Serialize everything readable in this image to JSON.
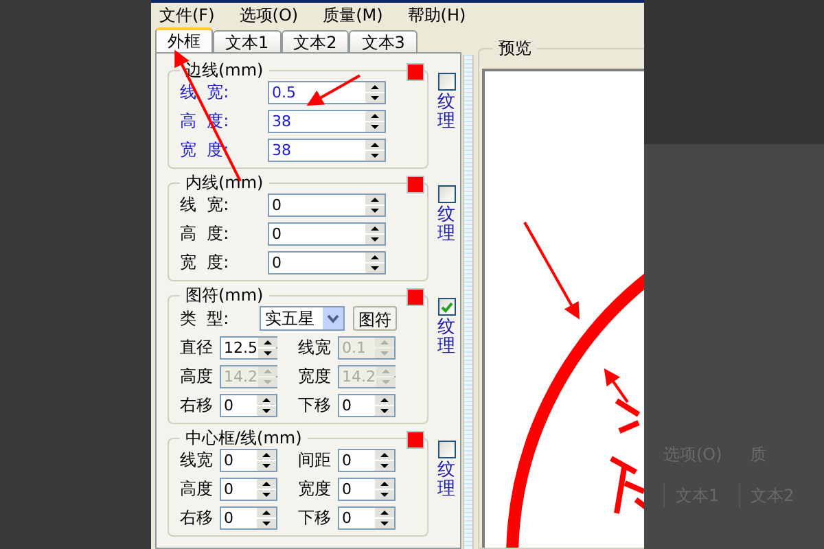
{
  "menu": [
    {
      "label": "文件(F)"
    },
    {
      "label": "选项(O)"
    },
    {
      "label": "质量(M)"
    },
    {
      "label": "帮助(H)"
    }
  ],
  "tabs": [
    {
      "label": "外框",
      "selected": true
    },
    {
      "label": "文本1",
      "selected": false
    },
    {
      "label": "文本2",
      "selected": false
    },
    {
      "label": "文本3",
      "selected": false
    }
  ],
  "groups": [
    {
      "kind": "single",
      "title": "边线(mm)",
      "highlighted": true,
      "color": "#ff0000",
      "texture": {
        "label": "纹理",
        "checked": false
      },
      "rows": [
        {
          "label": "线  宽:",
          "value": "0.5"
        },
        {
          "label": "高  度:",
          "value": "38"
        },
        {
          "label": "宽  度:",
          "value": "38"
        }
      ]
    },
    {
      "kind": "single",
      "title": "内线(mm)",
      "highlighted": false,
      "color": "#ff0000",
      "texture": {
        "label": "纹理",
        "checked": false
      },
      "rows": [
        {
          "label": "线  宽:",
          "value": "0"
        },
        {
          "label": "高  度:",
          "value": "0"
        },
        {
          "label": "宽  度:",
          "value": "0"
        }
      ]
    },
    {
      "kind": "pairs",
      "title": "图符(mm)",
      "color": "#ff0000",
      "texture": {
        "label": "纹理",
        "checked": true
      },
      "type_row": {
        "label": "类  型:",
        "select": "实五星",
        "button": "图符"
      },
      "fields": [
        {
          "label": "直径",
          "value": "12.5",
          "disabled": false
        },
        {
          "label": "线宽",
          "value": "0.1",
          "disabled": true
        },
        {
          "label": "高度",
          "value": "14.2",
          "disabled": true
        },
        {
          "label": "宽度",
          "value": "14.2",
          "disabled": true
        },
        {
          "label": "右移",
          "value": "0",
          "disabled": false
        },
        {
          "label": "下移",
          "value": "0",
          "disabled": false
        }
      ]
    },
    {
      "kind": "pairs",
      "title": "中心框/线(mm)",
      "color": "#ff0000",
      "texture": {
        "label": "纹理",
        "checked": false
      },
      "fields": [
        {
          "label": "线宽",
          "value": "0",
          "disabled": false
        },
        {
          "label": "间距",
          "value": "0",
          "disabled": false
        },
        {
          "label": "高度",
          "value": "0",
          "disabled": false
        },
        {
          "label": "宽度",
          "value": "0",
          "disabled": false
        },
        {
          "label": "右移",
          "value": "0",
          "disabled": false
        },
        {
          "label": "下移",
          "value": "0",
          "disabled": false
        }
      ]
    }
  ],
  "preview": {
    "title": "预览"
  },
  "background_window": {
    "menu": [
      {
        "label": "选项(O)"
      },
      {
        "label": "质"
      }
    ],
    "tabs": [
      {
        "label": "文本1"
      },
      {
        "label": "文本2"
      }
    ]
  }
}
